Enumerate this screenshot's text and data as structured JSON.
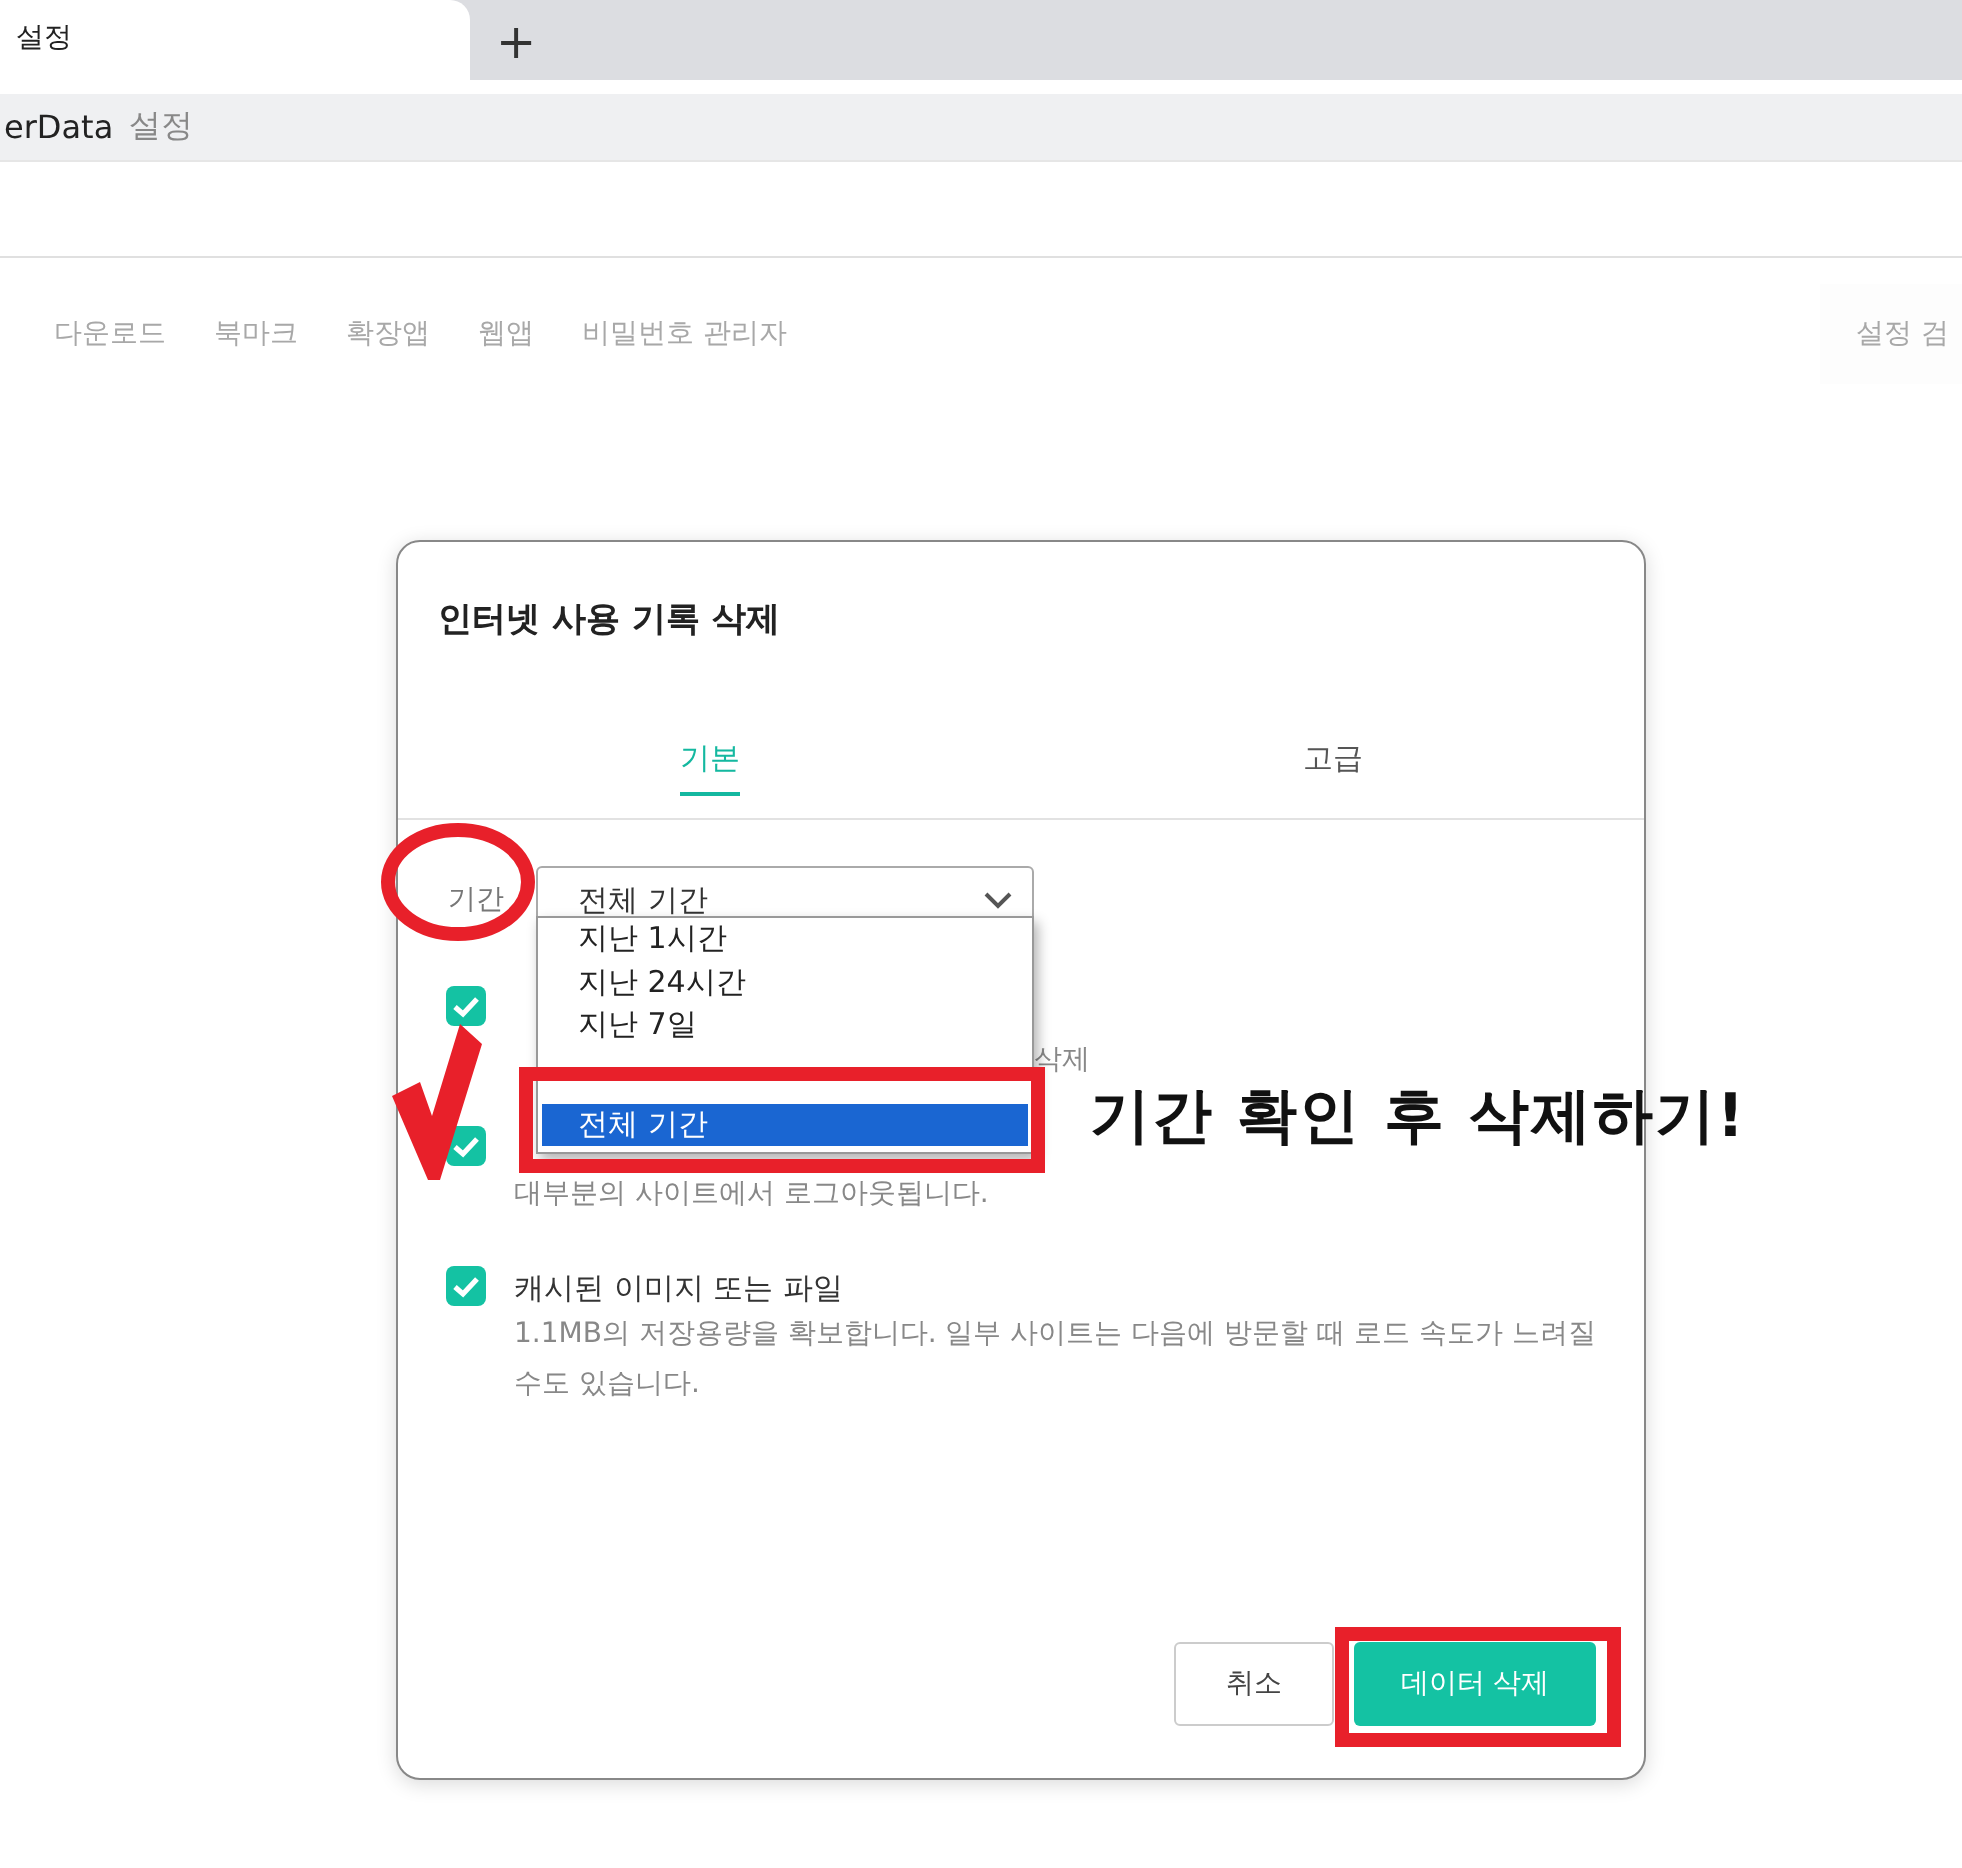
{
  "browser": {
    "tab": {
      "title": "설정",
      "selected": true
    },
    "new_tab": "+",
    "address": {
      "host": "erData",
      "page": "설정"
    }
  },
  "nav": {
    "items": [
      "다운로드",
      "북마크",
      "확장앱",
      "웹앱",
      "비밀번호 관리자"
    ],
    "search_button": "설정 검"
  },
  "dialog": {
    "title": "인터넷 사용 기록 삭제",
    "tabs": [
      {
        "label": "기본",
        "selected": true
      },
      {
        "label": "고급",
        "selected": false
      }
    ],
    "period": {
      "label": "기간",
      "value": "전체 기간",
      "options": [
        {
          "label": "지난 1시간",
          "selected": false
        },
        {
          "label": "지난 24시간",
          "selected": false
        },
        {
          "label": "지난 7일",
          "selected": false
        },
        {
          "label": "전체 기간",
          "selected": true
        }
      ]
    },
    "items": [
      {
        "kind": "tail",
        "description": "삭제",
        "checked": true
      },
      {
        "kind": "desc-only",
        "description": "대부분의 사이트에서 로그아웃됩니다.",
        "checked": true
      },
      {
        "kind": "full",
        "label": "캐시된 이미지 또는 파일",
        "description": "1.1MB의 저장용량을 확보합니다. 일부 사이트는 다음에 방문할 때 로드 속도가 느려질 수도 있습니다.",
        "checked": true
      }
    ],
    "buttons": [
      {
        "kind": "secondary",
        "label": "취소"
      },
      {
        "kind": "primary",
        "label": "데이터 삭제"
      }
    ]
  },
  "annotations": [
    {
      "kind": "circle"
    },
    {
      "kind": "check"
    },
    {
      "kind": "box"
    },
    {
      "kind": "text",
      "text": "기간 확인 후 삭제하기!"
    },
    {
      "kind": "box"
    }
  ]
}
